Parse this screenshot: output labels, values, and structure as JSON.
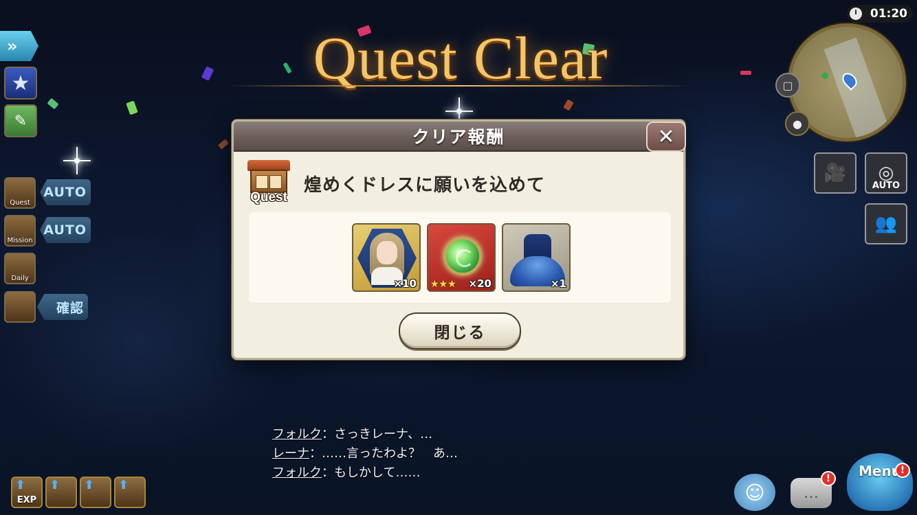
{
  "title": "Quest Clear",
  "dialog": {
    "title": "クリア報酬",
    "close_icon": "close-icon",
    "quest_icon_label": "Quest",
    "quest_name": "煌めくドレスに願いを込めて",
    "rewards": [
      {
        "name": "character-portrait",
        "count": "×10",
        "stars": ""
      },
      {
        "name": "green-orb",
        "count": "×20",
        "stars": "★★★"
      },
      {
        "name": "blue-dress",
        "count": "×1",
        "stars": ""
      }
    ],
    "close_button_label": "閉じる"
  },
  "hud": {
    "timer": "01:20",
    "fast_forward_icon": "fast-forward-icon",
    "left_menu": [
      {
        "label": "Quest",
        "tag": "AUTO"
      },
      {
        "label": "Mission",
        "tag": "AUTO"
      },
      {
        "label": "Daily",
        "tag": ""
      },
      {
        "label": "",
        "tag": "確認"
      }
    ],
    "right_buttons": [
      {
        "name": "camera-icon",
        "label": ""
      },
      {
        "name": "auto-camera-icon",
        "label": "AUTO"
      },
      {
        "name": "party-icon",
        "label": ""
      }
    ],
    "bottom_left": [
      {
        "label": "EXP"
      },
      {
        "label": ""
      },
      {
        "label": ""
      },
      {
        "label": ""
      }
    ],
    "menu_label": "Menu",
    "menu_badge": "!",
    "chat_badge": "!"
  },
  "chat": [
    {
      "speaker": "フォルク",
      "text": "：さっきレーナ、…"
    },
    {
      "speaker": "レーナ",
      "text": "：……言ったわよ？　あ…"
    },
    {
      "speaker": "フォルク",
      "text": "：もしかして……"
    }
  ],
  "colors": {
    "title_gold": "#f3c56b",
    "dialog_bg": "#f2efe1",
    "header_bg": "#6a5d5a"
  }
}
